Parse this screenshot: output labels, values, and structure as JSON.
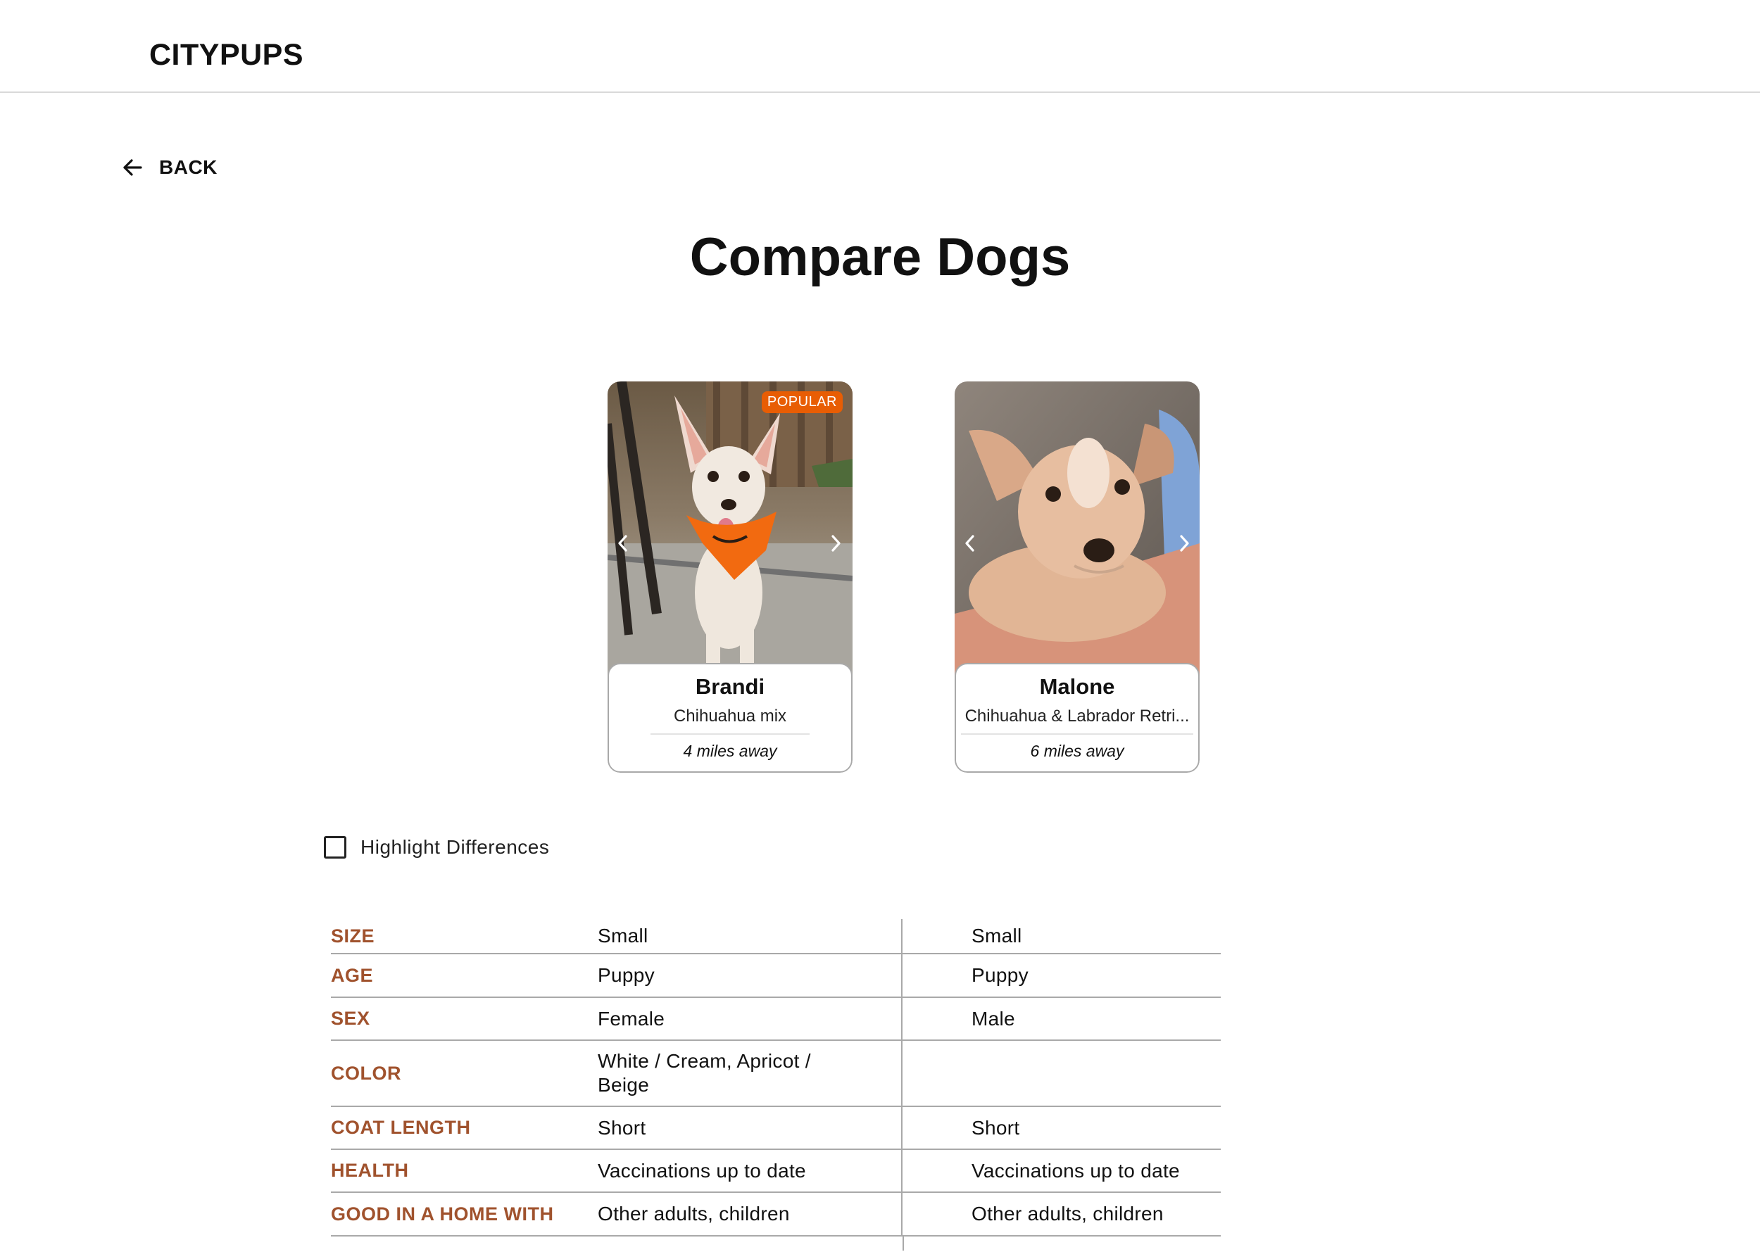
{
  "header": {
    "logo": "CITYPUPS"
  },
  "nav": {
    "back_label": "BACK"
  },
  "page": {
    "title": "Compare Dogs"
  },
  "dogs": [
    {
      "name": "Brandi",
      "breed": "Chihuahua mix",
      "distance": "4 miles away",
      "badge": "POPULAR"
    },
    {
      "name": "Malone",
      "breed": "Chihuahua & Labrador Retri...",
      "distance": "6 miles away"
    }
  ],
  "highlight": {
    "label": "Highlight Differences",
    "checked": false
  },
  "comparison": {
    "rows": [
      {
        "label": "SIZE",
        "dog1": "Small",
        "dog2": "Small"
      },
      {
        "label": "AGE",
        "dog1": "Puppy",
        "dog2": "Puppy"
      },
      {
        "label": "SEX",
        "dog1": "Female",
        "dog2": "Male"
      },
      {
        "label": "COLOR",
        "dog1": "White / Cream, Apricot / Beige",
        "dog2": ""
      },
      {
        "label": "COAT LENGTH",
        "dog1": "Short",
        "dog2": "Short"
      },
      {
        "label": "HEALTH",
        "dog1": "Vaccinations up to date",
        "dog2": "Vaccinations up to date"
      },
      {
        "label": "GOOD IN A HOME WITH",
        "dog1": "Other adults, children",
        "dog2": "Other adults, children"
      }
    ]
  },
  "colors": {
    "accent_label": "#a0522d",
    "badge": "#e85d04",
    "border": "#a9a9a9"
  },
  "icons": {
    "back": "arrow-left-icon",
    "prev": "chevron-left-icon",
    "next": "chevron-right-icon"
  }
}
